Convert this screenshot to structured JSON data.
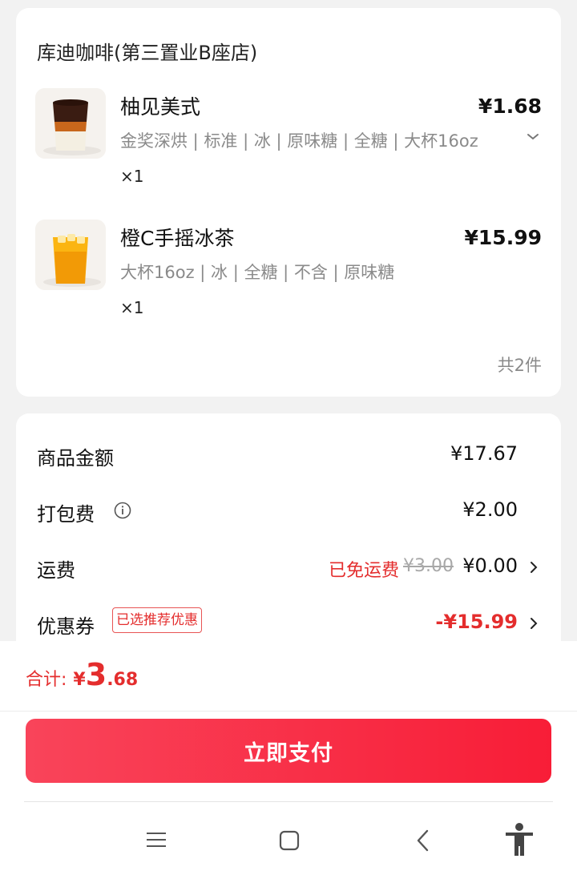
{
  "order": {
    "shop_name": "库迪咖啡(第三置业B座店)",
    "items": [
      {
        "name": "柚见美式",
        "price": "¥1.68",
        "specs": "金奖深烘 | 标准 | 冰 | 原味糖 | 全糖 | 大杯16oz",
        "qty": "×1",
        "icon": "iced-americano-cup-icon"
      },
      {
        "name": "橙C手摇冰茶",
        "price": "¥15.99",
        "specs": "大杯16oz | 冰 | 全糖 | 不含 | 原味糖",
        "qty": "×1",
        "icon": "orange-iced-tea-cup-icon"
      }
    ],
    "total_count": "共2件"
  },
  "fees": {
    "goods_label": "商品金额",
    "goods_value": "¥17.67",
    "packing_label": "打包费",
    "packing_value": "¥2.00",
    "delivery_label": "运费",
    "delivery_free_label": "已免运费",
    "delivery_original": "¥3.00",
    "delivery_value": "¥0.00",
    "coupon_label": "优惠券",
    "coupon_badge": "已选推荐优惠",
    "coupon_value": "-¥15.99"
  },
  "checkout": {
    "total_label": "合计:",
    "total_currency": "¥",
    "total_integer": "3",
    "total_decimal": ".68",
    "pay_button": "立即支付"
  },
  "colors": {
    "accent": "#f81d37",
    "price_red": "#e42d2d"
  }
}
